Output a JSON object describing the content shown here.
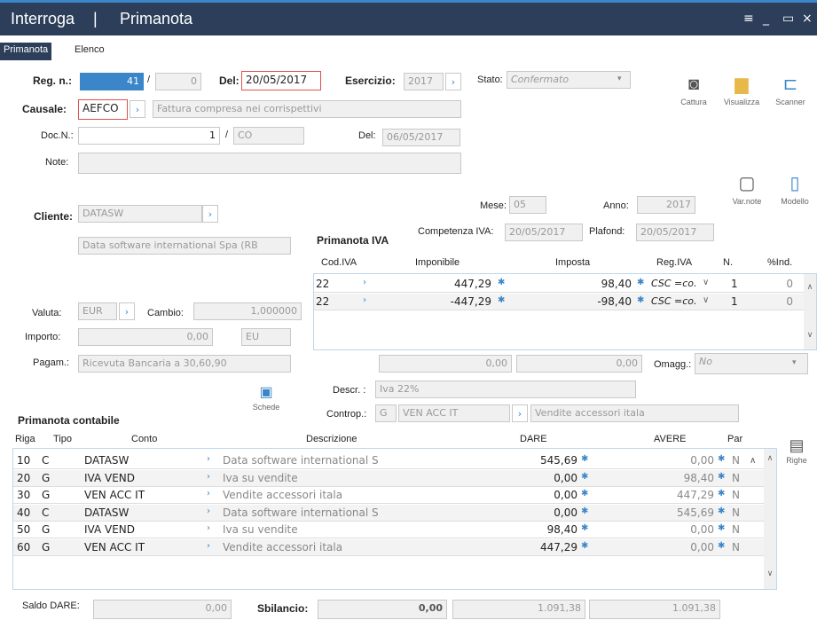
{
  "window": {
    "menu_title": "Interroga",
    "separator": "|",
    "title": "Primanota",
    "menu_icon": "≡",
    "min_icon": "_",
    "max_icon": "▭",
    "close_icon": "×"
  },
  "tabs": [
    {
      "label": "Primanota"
    },
    {
      "label": "Elenco"
    }
  ],
  "header": {
    "reg_label": "Reg. n.:",
    "reg_value": "41",
    "reg_sep": "/",
    "reg_sub": "0",
    "del_label": "Del:",
    "del_value": "20/05/2017",
    "esercizio_label": "Esercizio:",
    "esercizio_value": "2017",
    "stato_label": "Stato:",
    "stato_value": "Confermato",
    "causale_label": "Causale:",
    "causale_value": "AEFCO",
    "causale_desc": "Fattura compresa nei corrispettivi",
    "docn_label": "Doc.N.:",
    "docn_value": "1",
    "docn_sep": "/",
    "docn_series": "CO",
    "docdel_label": "Del:",
    "docdel_value": "06/05/2017",
    "note_label": "Note:",
    "note_value": ""
  },
  "toolbar": [
    {
      "label": "Cattura",
      "icon": "◙"
    },
    {
      "label": "Visualizza",
      "icon": "▆"
    },
    {
      "label": "Scanner",
      "icon": "⊏"
    },
    {
      "label": "Var.note",
      "icon": "▢"
    },
    {
      "label": "Modello",
      "icon": "▯"
    }
  ],
  "periodo": {
    "mese_label": "Mese:",
    "mese_value": "05",
    "anno_label": "Anno:",
    "anno_value": "2017",
    "competenza_label": "Competenza IVA:",
    "competenza_value": "20/05/2017",
    "plafond_label": "Plafond:",
    "plafond_value": "20/05/2017"
  },
  "cliente": {
    "label": "Cliente:",
    "code": "DATASW",
    "name": "Data software international  Spa (RB"
  },
  "valuta": {
    "label": "Valuta:",
    "value": "EUR",
    "cambio_label": "Cambio:",
    "cambio_value": "1,000000"
  },
  "importo": {
    "label": "Importo:",
    "value": "0,00",
    "unit": "EU"
  },
  "pagam": {
    "label": "Pagam.:",
    "value": "Ricevuta Bancaria a 30,60,90"
  },
  "schede_label": "Schede",
  "iva": {
    "title": "Primanota IVA",
    "columns": [
      "Cod.IVA",
      "Imponibile",
      "Imposta",
      "Reg.IVA",
      "N.",
      "%Ind."
    ],
    "rows": [
      {
        "cod": "22",
        "imponibile": "447,29",
        "imposta": "98,40",
        "reg": "CSC =co.",
        "n": "1",
        "ind": "0"
      },
      {
        "cod": "22",
        "imponibile": "-447,29",
        "imposta": "-98,40",
        "reg": "CSC =co.",
        "n": "1",
        "ind": "0"
      }
    ],
    "tot1": "0,00",
    "tot2": "0,00",
    "omagg_label": "Omagg.:",
    "omagg_value": "No",
    "descr_label": "Descr. :",
    "descr_value": "Iva 22%",
    "controp_label": "Controp.:",
    "controp_tipo": "G",
    "controp_code": "VEN ACC IT",
    "controp_desc": "Vendite accessori itala"
  },
  "contabile": {
    "title": "Primanota contabile",
    "columns": [
      "Riga",
      "Tipo",
      "Conto",
      "Descrizione",
      "DARE",
      "AVERE",
      "Par"
    ],
    "rows": [
      {
        "riga": "10",
        "tipo": "C",
        "conto": "DATASW",
        "desc": "Data software international  S",
        "dare": "545,69",
        "avere": "0,00",
        "par": "N"
      },
      {
        "riga": "20",
        "tipo": "G",
        "conto": "IVA VEND",
        "desc": "Iva su vendite",
        "dare": "0,00",
        "avere": "98,40",
        "par": "N"
      },
      {
        "riga": "30",
        "tipo": "G",
        "conto": "VEN ACC IT",
        "desc": "Vendite accessori itala",
        "dare": "0,00",
        "avere": "447,29",
        "par": "N"
      },
      {
        "riga": "40",
        "tipo": "C",
        "conto": "DATASW",
        "desc": "Data software international  S",
        "dare": "0,00",
        "avere": "545,69",
        "par": "N"
      },
      {
        "riga": "50",
        "tipo": "G",
        "conto": "IVA VEND",
        "desc": "Iva su vendite",
        "dare": "98,40",
        "avere": "0,00",
        "par": "N"
      },
      {
        "riga": "60",
        "tipo": "G",
        "conto": "VEN ACC IT",
        "desc": "Vendite accessori itala",
        "dare": "447,29",
        "avere": "0,00",
        "par": "N"
      }
    ],
    "righe_label": "Righe"
  },
  "footer": {
    "saldo_label": "Saldo DARE:",
    "saldo_value": "0,00",
    "sbil_label": "Sbilancio:",
    "sbil_value": "0,00",
    "tot_dare": "1.091,38",
    "tot_avere": "1.091,38"
  }
}
